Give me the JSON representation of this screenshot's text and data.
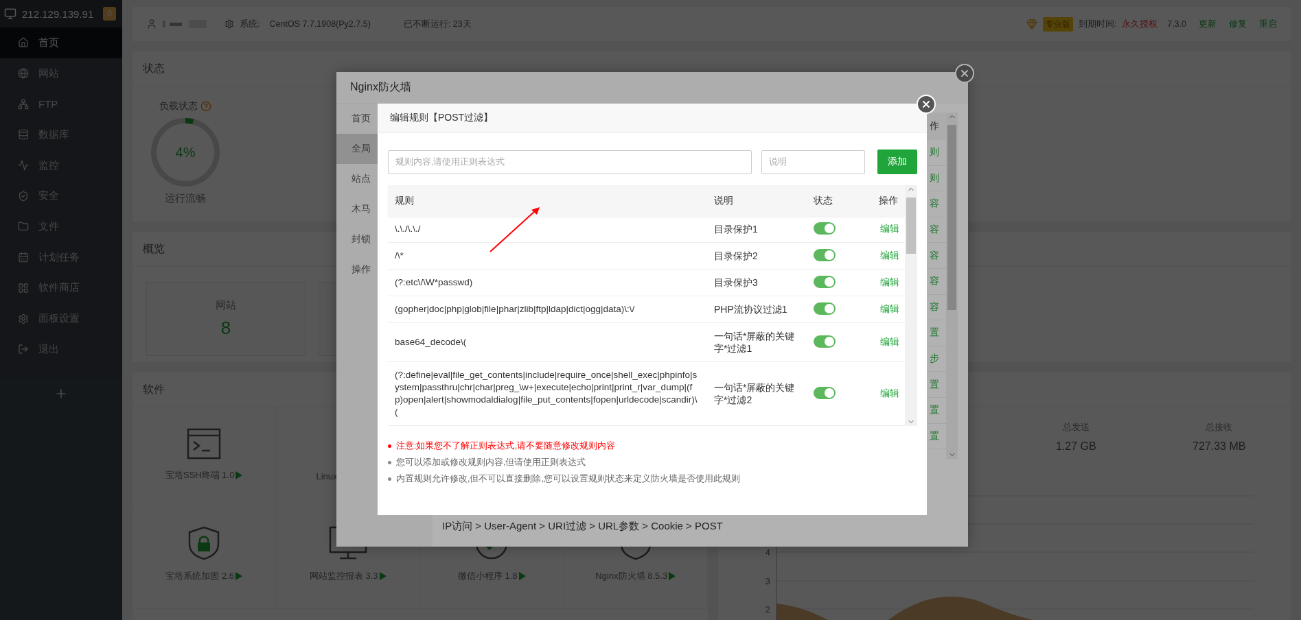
{
  "sidebar": {
    "host": "212.129.139.91",
    "badge": "0",
    "items": [
      {
        "label": "首页",
        "selected": true
      },
      {
        "label": "网站",
        "selected": false
      },
      {
        "label": "FTP",
        "selected": false
      },
      {
        "label": "数据库",
        "selected": false
      },
      {
        "label": "监控",
        "selected": false
      },
      {
        "label": "安全",
        "selected": false
      },
      {
        "label": "文件",
        "selected": false
      },
      {
        "label": "计划任务",
        "selected": false
      },
      {
        "label": "软件商店",
        "selected": false
      },
      {
        "label": "面板设置",
        "selected": false
      },
      {
        "label": "退出",
        "selected": false
      }
    ]
  },
  "topbar": {
    "system_label": "系统:",
    "system_value": "CentOS 7.7.1908(Py2.7.5)",
    "uptime": "已不断运行: 23天",
    "edition": "专业版",
    "expiry_label": "到期时间:",
    "expiry_value": "永久授权",
    "version": "7.3.0",
    "actions": [
      "更新",
      "修复",
      "重启"
    ]
  },
  "status_panel": {
    "title": "状态",
    "gauge": {
      "label": "负载状态",
      "value": "4%",
      "level": 0.04,
      "status": "运行流畅"
    }
  },
  "overview_panel": {
    "title": "概览",
    "cards": [
      {
        "label": "网站",
        "value": "8"
      }
    ]
  },
  "software_panel": {
    "title": "软件",
    "rows": [
      [
        {
          "name": "宝塔SSH终端 1.0"
        },
        {
          "name": "Linux"
        }
      ],
      [
        {
          "name": "宝塔系统加固 2.6"
        },
        {
          "name": "网站监控报表 3.3"
        },
        {
          "name": "微信小程序 1.8"
        },
        {
          "name": "Nginx防火墙 8.5.3"
        }
      ]
    ]
  },
  "traffic_panel": {
    "stats": [
      {
        "label": "总发送",
        "value": "1.27 GB"
      },
      {
        "label": "总接收",
        "value": "727.33 MB"
      }
    ],
    "y_ticks": [
      "4",
      "3",
      "2"
    ]
  },
  "outer_dialog": {
    "title": "Nginx防火墙",
    "nav": [
      {
        "label": "首页",
        "selected": false
      },
      {
        "label": "全局",
        "selected": true
      },
      {
        "label": "站点",
        "selected": false
      },
      {
        "label": "木马",
        "selected": false
      },
      {
        "label": "封锁",
        "selected": false
      },
      {
        "label": "操作",
        "selected": false
      }
    ],
    "op_header": "作",
    "op_cells": [
      "则",
      "则",
      "容",
      "容",
      "容",
      "容",
      "容",
      "置",
      "步",
      "置",
      "置",
      "置"
    ],
    "breadcrumb": "IP访问 > User-Agent > URI过滤 > URL参数 > Cookie > POST"
  },
  "dialog": {
    "title": "编辑规则【POST过滤】",
    "rule_input": {
      "placeholder": "规则内容,请使用正则表达式"
    },
    "desc_input": {
      "placeholder": "说明"
    },
    "add_button": "添加",
    "columns": [
      "规则",
      "说明",
      "状态",
      "操作"
    ],
    "rows": [
      {
        "rule": "\\.\\./\\.\\./",
        "note": "目录保护1",
        "on": true,
        "action": "编辑"
      },
      {
        "rule": "/\\*",
        "note": "目录保护2",
        "on": true,
        "action": "编辑"
      },
      {
        "rule": "(?:etc\\/\\W*passwd)",
        "note": "目录保护3",
        "on": true,
        "action": "编辑"
      },
      {
        "rule": "(gopher|doc|php|glob|file|phar|zlib|ftp|ldap|dict|ogg|data)\\:\\/",
        "note": "PHP流协议过滤1",
        "on": true,
        "action": "编辑"
      },
      {
        "rule": "base64_decode\\(",
        "note": "一句话*屏蔽的关键字*过滤1",
        "on": true,
        "action": "编辑"
      },
      {
        "rule": "(?:define|eval|file_get_contents|include|require_once|shell_exec|phpinfo|system|passthru|chr|char|preg_\\w+|execute|echo|print|print_r|var_dump|(fp)open|alert|showmodaldialog|file_put_contents|fopen|urldecode|scandir)\\(",
        "note": "一句话*屏蔽的关键字*过滤2",
        "on": true,
        "action": "编辑"
      }
    ],
    "notes": [
      {
        "kind": "warning",
        "text": "注意:如果您不了解正则表达式,请不要随意修改规则内容"
      },
      {
        "kind": "info",
        "text": "您可以添加或修改规则内容,但请使用正则表达式"
      },
      {
        "kind": "info",
        "text": "内置规则允许修改,但不可以直接删除,您可以设置规则状态来定义防火墙是否使用此规则"
      }
    ]
  }
}
